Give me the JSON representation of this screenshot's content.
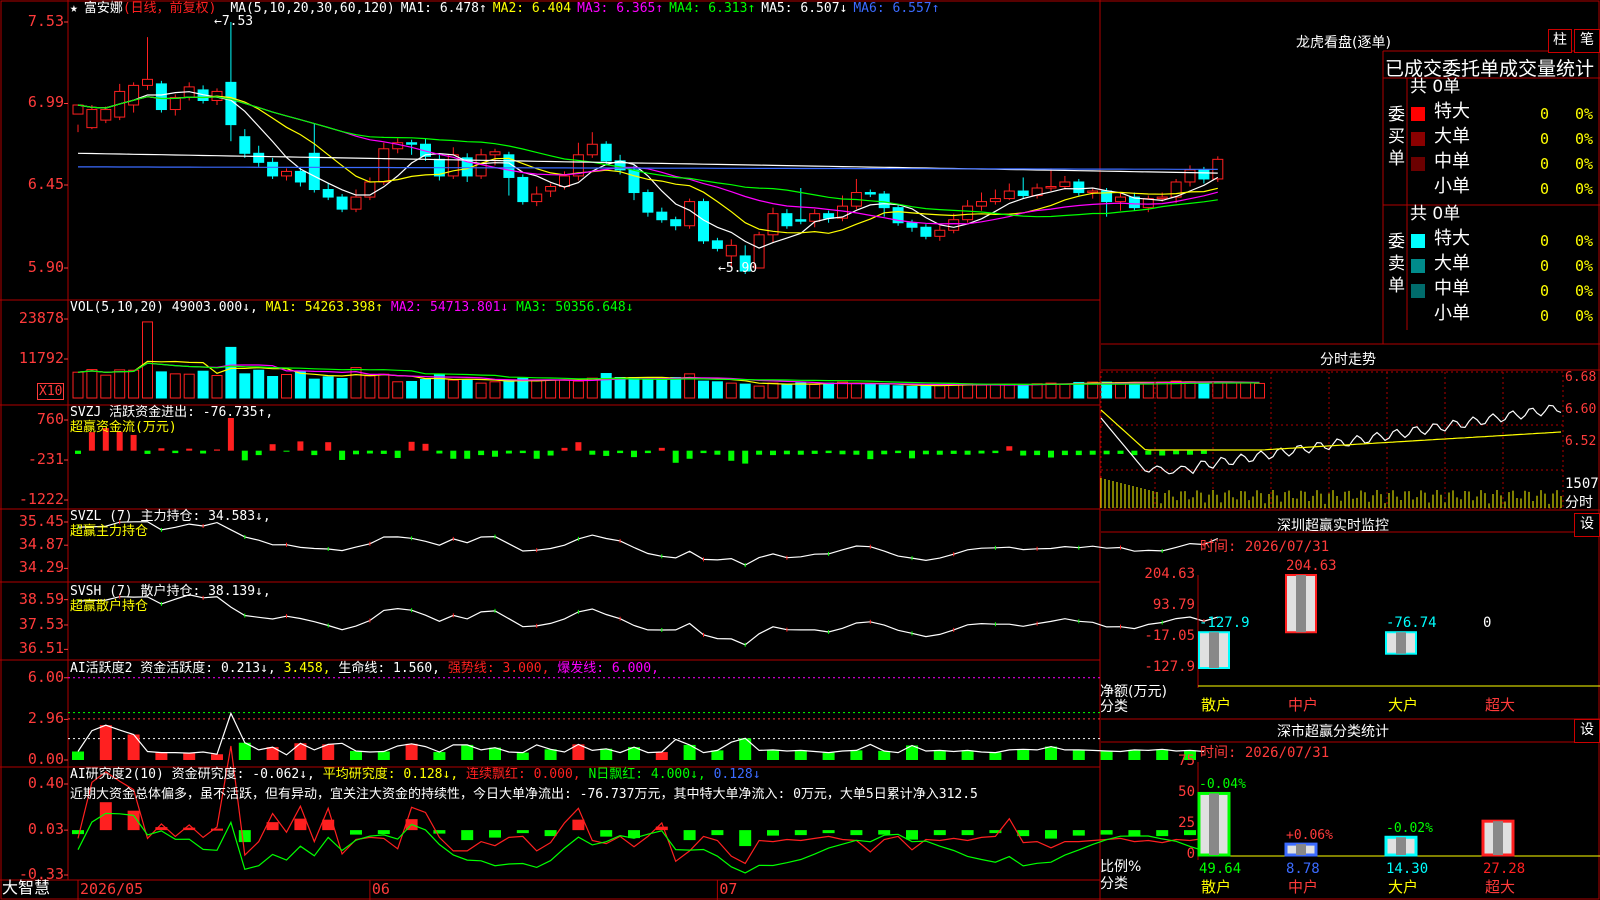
{
  "stock": {
    "star": "★",
    "name": "富安娜",
    "mode": "(日线，前复权)"
  },
  "ma_header": [
    {
      "text": "MA(5,10,20,30,60,120)",
      "color": "#ffffff"
    },
    {
      "text": "MA1: 6.478↑",
      "color": "#ffffff"
    },
    {
      "text": "MA2: 6.404",
      "color": "#ffff00"
    },
    {
      "text": "MA3: 6.365↑",
      "color": "#ff00ff"
    },
    {
      "text": "MA4: 6.313↑",
      "color": "#00ff00"
    },
    {
      "text": "MA5: 6.507↓",
      "color": "#ffffff"
    },
    {
      "text": "MA6: 6.557↑",
      "color": "#3b6bff"
    }
  ],
  "colors": {
    "up": "#ff2020",
    "down": "#00ffff",
    "grid": "#b00000",
    "ma5": "#ffffff",
    "ma10": "#ffff00",
    "ma20": "#ff00ff",
    "ma30": "#00ff00",
    "ma60": "#ffffff",
    "ma120": "#3b6bff"
  },
  "panels": {
    "vol": {
      "label": "VOL(5,10,20)",
      "val": "49003.000↓,",
      "ma1": "MA1: 54263.398↑",
      "ma2": "MA2: 54713.801↓",
      "ma3": "MA3: 50356.648↓",
      "unit": "X10"
    },
    "svzj": {
      "label": "SVZJ  活跃资金进出: -76.735↑,",
      "sub": "超赢资金流(万元)"
    },
    "svzl": {
      "label": "SVZL (7) 主力持仓: 34.583↓,",
      "sub": "超赢主力持仓"
    },
    "svsh": {
      "label": "SVSH (7) 散户持仓: 38.139↓,",
      "sub": "超赢散户持仓"
    },
    "ai1": {
      "label": "AI活跃度2 资金活跃度: 0.213↓,",
      "v2": "3.458,",
      "v3": "生命线: 1.560,",
      "v4": "强势线: 3.000,",
      "v5": "爆发线: 6.000,"
    },
    "ai2": {
      "label": "AI研究度2(10) 资金研究度: -0.062↓,",
      "v2": "平均研究度: 0.128↓,",
      "v3": "连续飘红: 0.000,",
      "v4": "N日飘红: 4.000↓,",
      "v5": "0.128↓",
      "note": "近期大资金总体偏多，虽不活跃，但有异动，宜关注大资金的持续性，今日大单净流出: -76.737万元，其中特大单净流入: 0万元，大单5日累计净入312.5"
    }
  },
  "annot": {
    "high": "7.53",
    "low": "5.90"
  },
  "footer": {
    "brand": "大智慧",
    "x_labels": [
      "2026/05",
      "06",
      "07"
    ]
  },
  "chart_data": [
    {
      "type": "candlestick",
      "title": "富安娜 日线",
      "ylim": [
        5.78,
        7.6
      ],
      "yticks": [
        "7.53",
        "6.99",
        "6.45",
        "5.90"
      ],
      "x_labels": [
        "2026/05",
        "06",
        "07"
      ],
      "ohlc": [
        [
          6.92,
          6.98,
          6.85,
          6.8
        ],
        [
          6.83,
          6.95,
          6.98,
          6.82
        ],
        [
          6.88,
          6.95,
          6.97,
          6.86
        ],
        [
          6.9,
          7.07,
          7.12,
          6.88
        ],
        [
          6.98,
          7.11,
          7.13,
          6.93
        ],
        [
          7.11,
          7.15,
          7.43,
          7.08
        ],
        [
          7.12,
          6.95,
          7.14,
          6.93
        ],
        [
          6.95,
          7.03,
          7.05,
          6.91
        ],
        [
          7.03,
          7.1,
          7.13,
          7.01
        ],
        [
          7.08,
          7.01,
          7.11,
          6.99
        ],
        [
          7.01,
          7.07,
          7.09,
          6.98
        ],
        [
          7.13,
          6.85,
          7.53,
          6.74
        ],
        [
          6.77,
          6.66,
          6.82,
          6.63
        ],
        [
          6.66,
          6.6,
          6.71,
          6.57
        ],
        [
          6.6,
          6.51,
          6.63,
          6.49
        ],
        [
          6.51,
          6.54,
          6.56,
          6.48
        ],
        [
          6.54,
          6.47,
          6.57,
          6.44
        ],
        [
          6.66,
          6.42,
          6.86,
          6.4
        ],
        [
          6.42,
          6.37,
          6.46,
          6.35
        ],
        [
          6.37,
          6.29,
          6.39,
          6.27
        ],
        [
          6.29,
          6.37,
          6.42,
          6.27
        ],
        [
          6.37,
          6.47,
          6.5,
          6.35
        ],
        [
          6.47,
          6.69,
          6.73,
          6.45
        ],
        [
          6.69,
          6.73,
          6.76,
          6.66
        ],
        [
          6.73,
          6.72,
          6.75,
          6.65
        ],
        [
          6.72,
          6.64,
          6.76,
          6.61
        ],
        [
          6.62,
          6.51,
          6.66,
          6.48
        ],
        [
          6.51,
          6.65,
          6.7,
          6.49
        ],
        [
          6.63,
          6.51,
          6.66,
          6.47
        ],
        [
          6.51,
          6.65,
          6.69,
          6.49
        ],
        [
          6.65,
          6.67,
          6.69,
          6.58
        ],
        [
          6.65,
          6.5,
          6.67,
          6.38
        ],
        [
          6.5,
          6.34,
          6.52,
          6.32
        ],
        [
          6.34,
          6.39,
          6.44,
          6.31
        ],
        [
          6.41,
          6.44,
          6.46,
          6.37
        ],
        [
          6.44,
          6.51,
          6.54,
          6.42
        ],
        [
          6.51,
          6.65,
          6.73,
          6.48
        ],
        [
          6.65,
          6.72,
          6.8,
          6.63
        ],
        [
          6.72,
          6.61,
          6.74,
          6.58
        ],
        [
          6.61,
          6.55,
          6.65,
          6.52
        ],
        [
          6.55,
          6.4,
          6.58,
          6.35
        ],
        [
          6.4,
          6.27,
          6.42,
          6.24
        ],
        [
          6.27,
          6.22,
          6.3,
          6.2
        ],
        [
          6.22,
          6.18,
          6.24,
          6.15
        ],
        [
          6.18,
          6.34,
          6.36,
          6.16
        ],
        [
          6.34,
          6.08,
          6.36,
          6.06
        ],
        [
          6.08,
          6.03,
          6.1,
          6.01
        ],
        [
          5.98,
          6.05,
          6.09,
          5.9
        ],
        [
          5.98,
          5.88,
          6.05,
          5.86
        ],
        [
          5.9,
          6.12,
          6.14,
          5.9
        ],
        [
          6.12,
          6.26,
          6.3,
          6.07
        ],
        [
          6.26,
          6.18,
          6.29,
          6.16
        ],
        [
          6.22,
          6.21,
          6.43,
          6.19
        ],
        [
          6.21,
          6.26,
          6.29,
          6.17
        ],
        [
          6.26,
          6.23,
          6.28,
          6.2
        ],
        [
          6.23,
          6.31,
          6.38,
          6.21
        ],
        [
          6.31,
          6.4,
          6.49,
          6.29
        ],
        [
          6.4,
          6.39,
          6.42,
          6.37
        ],
        [
          6.39,
          6.3,
          6.41,
          6.24
        ],
        [
          6.3,
          6.2,
          6.32,
          6.18
        ],
        [
          6.2,
          6.17,
          6.22,
          6.14
        ],
        [
          6.17,
          6.11,
          6.19,
          6.09
        ],
        [
          6.11,
          6.15,
          6.18,
          6.08
        ],
        [
          6.15,
          6.22,
          6.26,
          6.13
        ],
        [
          6.22,
          6.31,
          6.35,
          6.2
        ],
        [
          6.31,
          6.34,
          6.4,
          6.28
        ],
        [
          6.34,
          6.36,
          6.42,
          6.32
        ],
        [
          6.36,
          6.41,
          6.46,
          6.35
        ],
        [
          6.41,
          6.38,
          6.5,
          6.36
        ],
        [
          6.38,
          6.43,
          6.46,
          6.36
        ],
        [
          6.43,
          6.44,
          6.56,
          6.41
        ],
        [
          6.44,
          6.47,
          6.51,
          6.42
        ],
        [
          6.47,
          6.4,
          6.49,
          6.38
        ],
        [
          6.4,
          6.41,
          6.43,
          6.36
        ],
        [
          6.41,
          6.34,
          6.43,
          6.24
        ],
        [
          6.34,
          6.37,
          6.4,
          6.28
        ],
        [
          6.37,
          6.3,
          6.4,
          6.28
        ],
        [
          6.3,
          6.36,
          6.38,
          6.27
        ],
        [
          6.36,
          6.37,
          6.4,
          6.34
        ],
        [
          6.37,
          6.47,
          6.49,
          6.33
        ],
        [
          6.47,
          6.55,
          6.58,
          6.44
        ],
        [
          6.55,
          6.49,
          6.57,
          6.46
        ],
        [
          6.49,
          6.62,
          6.64,
          6.47
        ]
      ],
      "ma_levels": [
        6.478,
        6.404,
        6.365,
        6.313,
        6.507,
        6.557
      ]
    },
    {
      "type": "bar",
      "title": "VOL(5,10,20)",
      "yticks": [
        "23878",
        "11792"
      ],
      "ylim": [
        0,
        26000
      ],
      "values": [
        7800,
        8600,
        6900,
        8500,
        8400,
        23000,
        7900,
        7300,
        7200,
        8100,
        6800,
        15300,
        7300,
        8400,
        6500,
        7100,
        8100,
        5700,
        6400,
        5900,
        9200,
        6700,
        7200,
        4900,
        5000,
        5600,
        7000,
        5400,
        5400,
        4500,
        4900,
        5300,
        6000,
        5200,
        5400,
        5400,
        5100,
        6000,
        7400,
        6200,
        6200,
        5500,
        5800,
        6200,
        7300,
        5100,
        4900,
        4500,
        4200,
        3600,
        4500,
        4200,
        4600,
        4100,
        4500,
        4800,
        4400,
        4200,
        3900,
        3700,
        3500,
        3700,
        3900,
        4400,
        4300,
        3900,
        4000,
        4100,
        4100,
        4300,
        4500,
        4200,
        4700,
        4800,
        4800,
        4700,
        4700,
        4700,
        4800,
        5100,
        4900,
        4700,
        4800,
        4700,
        4500,
        4400
      ]
    },
    {
      "type": "bar",
      "title": "超赢资金流(万元)",
      "yticks": [
        "760",
        "-231",
        "-1222"
      ],
      "ylim": [
        -1250,
        790
      ],
      "values": [
        -80,
        460,
        560,
        470,
        390,
        -80,
        60,
        -60,
        50,
        -70,
        30,
        810,
        -240,
        -110,
        160,
        -20,
        230,
        -110,
        210,
        -230,
        -90,
        -70,
        -80,
        -180,
        220,
        170,
        -70,
        -200,
        -200,
        -110,
        -150,
        -70,
        -60,
        -200,
        -120,
        70,
        210,
        -100,
        -130,
        -60,
        -160,
        -60,
        70,
        -300,
        -200,
        -60,
        -100,
        -250,
        -320,
        -100,
        -110,
        -90,
        -100,
        -80,
        -60,
        -90,
        -100,
        -210,
        -90,
        -60,
        -190,
        -90,
        -100,
        -80,
        -100,
        -70,
        -60,
        110,
        -120,
        -110,
        -170,
        -110,
        -110,
        -100,
        -90,
        -80,
        -110,
        -100,
        -120,
        -90,
        -100,
        -80
      ]
    },
    {
      "type": "line",
      "title": "超赢主力持仓",
      "yticks": [
        "35.45",
        "34.87",
        "34.29"
      ],
      "ylim": [
        34.25,
        35.5
      ]
    },
    {
      "type": "line",
      "title": "超赢散户持仓",
      "yticks": [
        "38.59",
        "37.53",
        "36.51"
      ],
      "ylim": [
        36.4,
        38.7
      ]
    },
    {
      "type": "bar",
      "title": "AI活跃度2",
      "yticks": [
        "6.00",
        "2.96",
        "0.00"
      ],
      "ylim": [
        0,
        6.2
      ]
    },
    {
      "type": "bar",
      "title": "AI研究度2(10)",
      "yticks": [
        "0.40",
        "0.03",
        "-0.33"
      ],
      "ylim": [
        -0.36,
        0.43
      ]
    }
  ],
  "right_panel": {
    "tabs": [
      "柱",
      "笔"
    ],
    "title": "龙虎看盘(逐单)",
    "subtitle": "已成交委托单成交量统计",
    "buy": {
      "vertical": [
        "委",
        "买",
        "单"
      ],
      "total": "共 0单",
      "rows": [
        {
          "label": "特大",
          "count": "0",
          "pct": "0%",
          "color": "#ff0000"
        },
        {
          "label": "大单",
          "count": "0",
          "pct": "0%",
          "color": "#8b0000"
        },
        {
          "label": "中单",
          "count": "0",
          "pct": "0%",
          "color": "#6b0000"
        },
        {
          "label": "小单",
          "count": "0",
          "pct": "0%",
          "color": "#000000"
        }
      ]
    },
    "sell": {
      "vertical": [
        "委",
        "卖",
        "单"
      ],
      "total": "共 0单",
      "rows": [
        {
          "label": "特大",
          "count": "0",
          "pct": "0%",
          "color": "#00ffff"
        },
        {
          "label": "大单",
          "count": "0",
          "pct": "0%",
          "color": "#008b8b"
        },
        {
          "label": "中单",
          "count": "0",
          "pct": "0%",
          "color": "#006b6b"
        },
        {
          "label": "小单",
          "count": "0",
          "pct": "0%",
          "color": "#000000"
        }
      ]
    },
    "intraday": {
      "title": "分时走势",
      "y": [
        "6.68",
        "6.60",
        "6.52"
      ],
      "vol": "1507",
      "unit": "分时"
    },
    "monitor": {
      "title": "深圳超赢实时监控",
      "btn": "设",
      "time": "时间: 2026/07/31",
      "yticks": [
        "204.63",
        "93.79",
        "-17.05",
        "-127.9"
      ],
      "ylabel": "净额(万元)",
      "xcat": "分类",
      "categories": [
        "散户",
        "中户",
        "大户",
        "超大"
      ],
      "values": [
        -127.9,
        204.63,
        -76.74,
        0
      ],
      "labels": [
        "-127.9",
        "204.63",
        "-76.74",
        "0"
      ]
    },
    "classify": {
      "title": "深市超赢分类统计",
      "btn": "设",
      "time": "时间: 2026/07/31",
      "yticks": [
        "75",
        "50",
        "25",
        "0"
      ],
      "ylabel": "比例%",
      "xcat": "分类",
      "categories": [
        "散户",
        "中户",
        "大户",
        "超大"
      ],
      "values": [
        49.64,
        8.78,
        14.3,
        27.28
      ],
      "values_text": [
        "49.64",
        "8.78",
        "14.30",
        "27.28"
      ],
      "deltas": [
        "-0.04%",
        "+0.06%",
        "-0.02%",
        ""
      ]
    }
  }
}
